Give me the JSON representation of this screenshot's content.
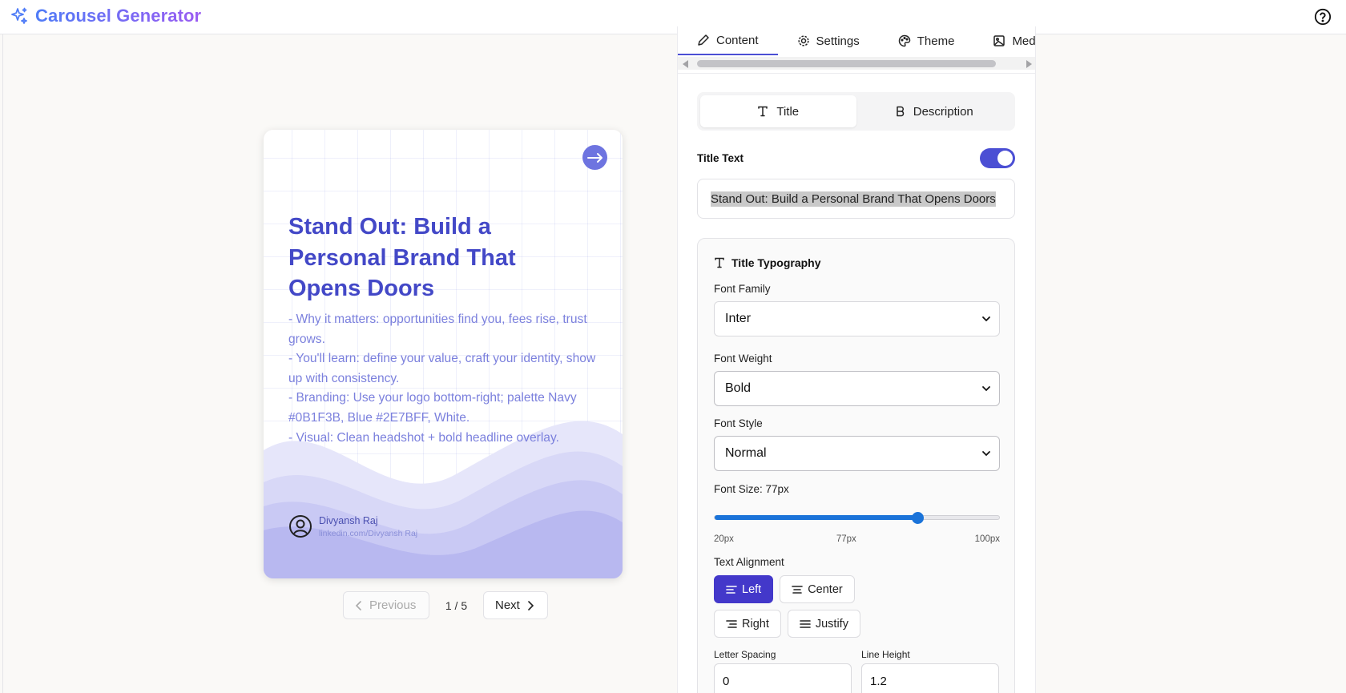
{
  "app": {
    "title": "Carousel Generator",
    "brand_gradient": [
      "#4f7cf7",
      "#9b5cf2"
    ]
  },
  "slide": {
    "title": "Stand Out: Build a Personal Brand That Opens Doors",
    "description_lines": [
      "- Why it matters: opportunities find you, fees rise, trust grows.",
      "- You'll learn: define your value, craft your identity, show up with consistency.",
      "- Branding: Use your logo bottom-right; palette Navy #0B1F3B, Blue #2E7BFF, White.",
      "- Visual: Clean headshot + bold headline overlay."
    ],
    "author_name": "Divyansh Raj",
    "author_url": "linkedin.com/Divyansh Raj",
    "title_color": "#4348c7",
    "desc_color": "#7b80dd"
  },
  "pager": {
    "previous_label": "Previous",
    "next_label": "Next",
    "count": "1 / 5"
  },
  "tabs": [
    {
      "label": "Content",
      "icon": "pencil-icon"
    },
    {
      "label": "Settings",
      "icon": "gear-icon"
    },
    {
      "label": "Theme",
      "icon": "palette-icon"
    },
    {
      "label": "Media",
      "icon": "image-icon"
    }
  ],
  "segments": {
    "title_label": "Title",
    "description_label": "Description"
  },
  "title_text": {
    "label": "Title Text",
    "enabled": true,
    "value": "Stand Out: Build a Personal Brand That Opens Doors"
  },
  "typography": {
    "heading": "Title Typography",
    "font_family_label": "Font Family",
    "font_family_value": "Inter",
    "font_weight_label": "Font Weight",
    "font_weight_value": "Bold",
    "font_style_label": "Font Style",
    "font_style_value": "Normal",
    "font_size_label": "Font Size: 77px",
    "font_size_min": "20px",
    "font_size_mid": "77px",
    "font_size_max": "100px",
    "font_size_value": 77,
    "font_size_range": [
      20,
      100
    ],
    "text_alignment_label": "Text Alignment",
    "align_left": "Left",
    "align_center": "Center",
    "align_right": "Right",
    "align_justify": "Justify",
    "letter_spacing_label": "Letter Spacing",
    "letter_spacing_value": "0",
    "line_height_label": "Line Height",
    "line_height_value": "1.2"
  },
  "colors": {
    "accent": "#4338ca",
    "slider": "#1a73d9"
  }
}
